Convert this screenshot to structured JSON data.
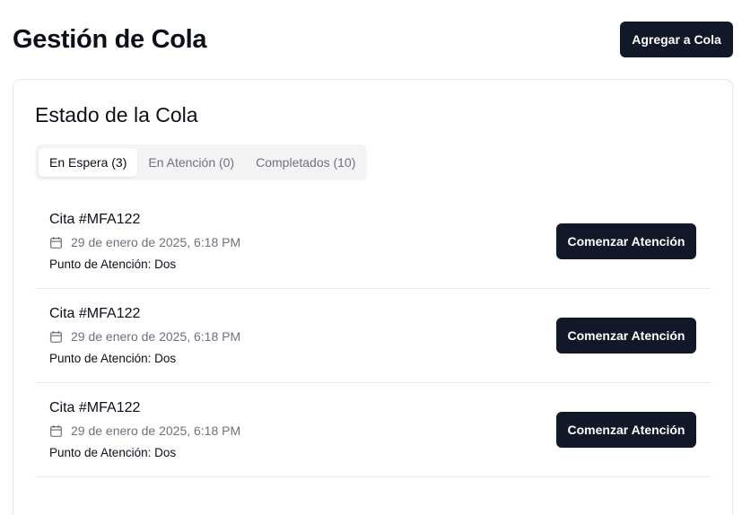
{
  "header": {
    "title": "Gestión de Cola",
    "add_button": "Agregar a Cola"
  },
  "queue_card": {
    "title": "Estado de la Cola",
    "tabs": [
      {
        "label": "En Espera (3)",
        "active": true
      },
      {
        "label": "En Atención (0)",
        "active": false
      },
      {
        "label": "Completados (10)",
        "active": false
      }
    ],
    "items": [
      {
        "title": "Cita #MFA122",
        "date": "29 de enero de 2025, 6:18 PM",
        "point": "Punto de Atención: Dos",
        "action": "Comenzar Atención",
        "icon": "calendar-icon"
      },
      {
        "title": "Cita #MFA122",
        "date": "29 de enero de 2025, 6:18 PM",
        "point": "Punto de Atención: Dos",
        "action": "Comenzar Atención",
        "icon": "calendar-icon"
      },
      {
        "title": "Cita #MFA122",
        "date": "29 de enero de 2025, 6:18 PM",
        "point": "Punto de Atención: Dos",
        "action": "Comenzar Atención",
        "icon": "calendar-icon"
      }
    ]
  },
  "colors": {
    "primary": "#111827",
    "muted_text": "#6b7280",
    "border": "#e5e7eb",
    "tab_bg": "#f4f4f5"
  }
}
